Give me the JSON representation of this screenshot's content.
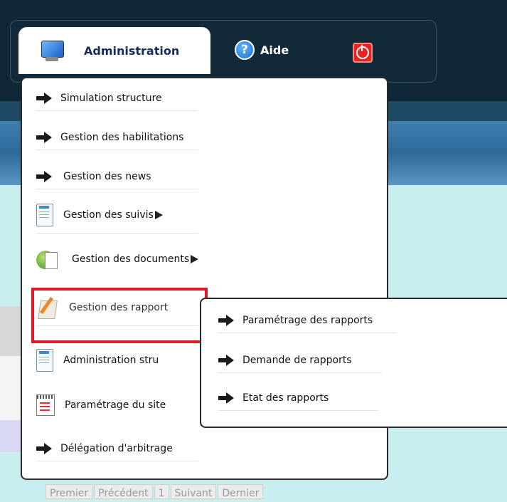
{
  "navbar": {
    "tab_label": "Administration",
    "help_label": "Aide"
  },
  "menu": {
    "items": [
      {
        "label": "Simulation structure",
        "icon": "arrow-right-icon"
      },
      {
        "label": "Gestion des habilitations",
        "icon": "arrow-right-icon"
      },
      {
        "label": "Gestion des news",
        "icon": "arrow-right-icon"
      },
      {
        "label": "Gestion des suivis",
        "icon": "document-icon"
      },
      {
        "label": "Gestion des documents",
        "icon": "documents-globe-icon"
      },
      {
        "label": "Gestion des rapport",
        "icon": "notepad-pencil-icon"
      },
      {
        "label": "Administration stru",
        "icon": "document-icon"
      },
      {
        "label": "Paramétrage du site",
        "icon": "calendar-icon"
      },
      {
        "label": "Délégation d'arbitrage",
        "icon": "arrow-right-icon"
      }
    ]
  },
  "submenu": {
    "items": [
      {
        "label": "Paramétrage des rapports"
      },
      {
        "label": "Demande de rapports"
      },
      {
        "label": "Etat des rapports"
      }
    ]
  },
  "pager": {
    "first": "Premier",
    "prev": "Précédent",
    "page": "1",
    "next": "Suivant",
    "last": "Dernier"
  },
  "colors": {
    "highlight": "#e01b24",
    "header_bg": "#0f2838"
  }
}
